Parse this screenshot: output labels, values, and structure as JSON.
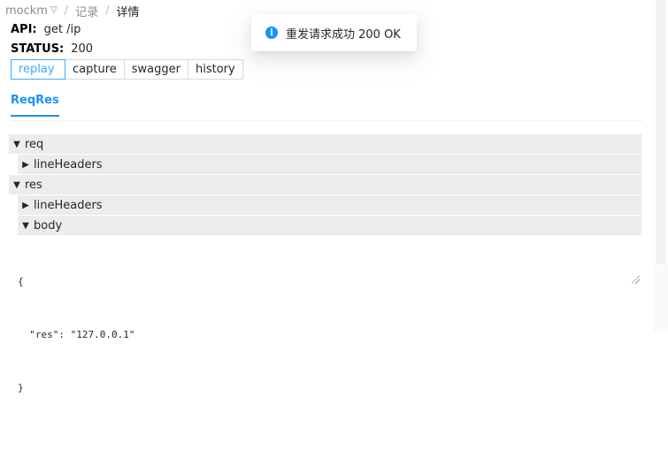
{
  "breadcrumb": {
    "app": "mockm",
    "separator": "/",
    "section": "记录",
    "current": "详情"
  },
  "info": {
    "api_label": "API:",
    "api_value": "get /ip",
    "status_label": "STATUS:",
    "status_value": "200"
  },
  "actions": {
    "replay": "replay",
    "capture": "capture",
    "swagger": "swagger",
    "history": "history"
  },
  "tabs": [
    {
      "label": "ReqRes",
      "active": true
    }
  ],
  "tree": {
    "req": "req",
    "req_lineHeaders": "lineHeaders",
    "res": "res",
    "res_lineHeaders": "lineHeaders",
    "body": "body"
  },
  "body_code": {
    "line1": "{",
    "line2": "  \"res\": \"127.0.0.1\"",
    "line3": "}"
  },
  "toast": {
    "icon": "info-icon",
    "message": "重发请求成功 200 OK"
  },
  "colors": {
    "accent": "#1890ff",
    "active_button": "#40a9ff",
    "node_background": "#ececec"
  }
}
